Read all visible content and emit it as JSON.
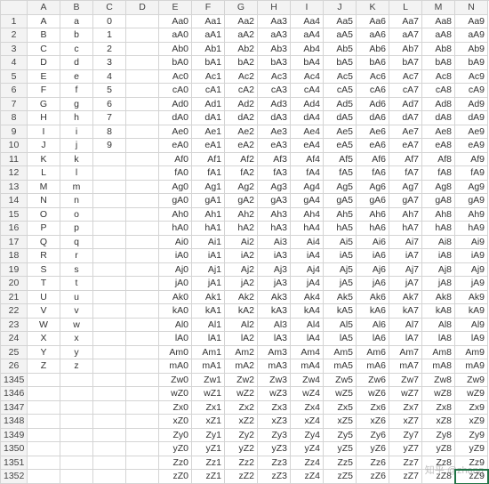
{
  "columns": [
    "A",
    "B",
    "C",
    "D",
    "E",
    "F",
    "G",
    "H",
    "I",
    "J",
    "K",
    "L",
    "M",
    "N"
  ],
  "rows": [
    {
      "n": "1",
      "A": "A",
      "B": "a",
      "C": "0",
      "D": "",
      "E": "Aa0",
      "F": "Aa1",
      "G": "Aa2",
      "H": "Aa3",
      "I": "Aa4",
      "J": "Aa5",
      "K": "Aa6",
      "L": "Aa7",
      "M": "Aa8",
      "N": "Aa9"
    },
    {
      "n": "2",
      "A": "B",
      "B": "b",
      "C": "1",
      "D": "",
      "E": "aA0",
      "F": "aA1",
      "G": "aA2",
      "H": "aA3",
      "I": "aA4",
      "J": "aA5",
      "K": "aA6",
      "L": "aA7",
      "M": "aA8",
      "N": "aA9"
    },
    {
      "n": "3",
      "A": "C",
      "B": "c",
      "C": "2",
      "D": "",
      "E": "Ab0",
      "F": "Ab1",
      "G": "Ab2",
      "H": "Ab3",
      "I": "Ab4",
      "J": "Ab5",
      "K": "Ab6",
      "L": "Ab7",
      "M": "Ab8",
      "N": "Ab9"
    },
    {
      "n": "4",
      "A": "D",
      "B": "d",
      "C": "3",
      "D": "",
      "E": "bA0",
      "F": "bA1",
      "G": "bA2",
      "H": "bA3",
      "I": "bA4",
      "J": "bA5",
      "K": "bA6",
      "L": "bA7",
      "M": "bA8",
      "N": "bA9"
    },
    {
      "n": "5",
      "A": "E",
      "B": "e",
      "C": "4",
      "D": "",
      "E": "Ac0",
      "F": "Ac1",
      "G": "Ac2",
      "H": "Ac3",
      "I": "Ac4",
      "J": "Ac5",
      "K": "Ac6",
      "L": "Ac7",
      "M": "Ac8",
      "N": "Ac9"
    },
    {
      "n": "6",
      "A": "F",
      "B": "f",
      "C": "5",
      "D": "",
      "E": "cA0",
      "F": "cA1",
      "G": "cA2",
      "H": "cA3",
      "I": "cA4",
      "J": "cA5",
      "K": "cA6",
      "L": "cA7",
      "M": "cA8",
      "N": "cA9"
    },
    {
      "n": "7",
      "A": "G",
      "B": "g",
      "C": "6",
      "D": "",
      "E": "Ad0",
      "F": "Ad1",
      "G": "Ad2",
      "H": "Ad3",
      "I": "Ad4",
      "J": "Ad5",
      "K": "Ad6",
      "L": "Ad7",
      "M": "Ad8",
      "N": "Ad9"
    },
    {
      "n": "8",
      "A": "H",
      "B": "h",
      "C": "7",
      "D": "",
      "E": "dA0",
      "F": "dA1",
      "G": "dA2",
      "H": "dA3",
      "I": "dA4",
      "J": "dA5",
      "K": "dA6",
      "L": "dA7",
      "M": "dA8",
      "N": "dA9"
    },
    {
      "n": "9",
      "A": "I",
      "B": "i",
      "C": "8",
      "D": "",
      "E": "Ae0",
      "F": "Ae1",
      "G": "Ae2",
      "H": "Ae3",
      "I": "Ae4",
      "J": "Ae5",
      "K": "Ae6",
      "L": "Ae7",
      "M": "Ae8",
      "N": "Ae9"
    },
    {
      "n": "10",
      "A": "J",
      "B": "j",
      "C": "9",
      "D": "",
      "E": "eA0",
      "F": "eA1",
      "G": "eA2",
      "H": "eA3",
      "I": "eA4",
      "J": "eA5",
      "K": "eA6",
      "L": "eA7",
      "M": "eA8",
      "N": "eA9"
    },
    {
      "n": "11",
      "A": "K",
      "B": "k",
      "C": "",
      "D": "",
      "E": "Af0",
      "F": "Af1",
      "G": "Af2",
      "H": "Af3",
      "I": "Af4",
      "J": "Af5",
      "K": "Af6",
      "L": "Af7",
      "M": "Af8",
      "N": "Af9"
    },
    {
      "n": "12",
      "A": "L",
      "B": "l",
      "C": "",
      "D": "",
      "E": "fA0",
      "F": "fA1",
      "G": "fA2",
      "H": "fA3",
      "I": "fA4",
      "J": "fA5",
      "K": "fA6",
      "L": "fA7",
      "M": "fA8",
      "N": "fA9"
    },
    {
      "n": "13",
      "A": "M",
      "B": "m",
      "C": "",
      "D": "",
      "E": "Ag0",
      "F": "Ag1",
      "G": "Ag2",
      "H": "Ag3",
      "I": "Ag4",
      "J": "Ag5",
      "K": "Ag6",
      "L": "Ag7",
      "M": "Ag8",
      "N": "Ag9"
    },
    {
      "n": "14",
      "A": "N",
      "B": "n",
      "C": "",
      "D": "",
      "E": "gA0",
      "F": "gA1",
      "G": "gA2",
      "H": "gA3",
      "I": "gA4",
      "J": "gA5",
      "K": "gA6",
      "L": "gA7",
      "M": "gA8",
      "N": "gA9"
    },
    {
      "n": "15",
      "A": "O",
      "B": "o",
      "C": "",
      "D": "",
      "E": "Ah0",
      "F": "Ah1",
      "G": "Ah2",
      "H": "Ah3",
      "I": "Ah4",
      "J": "Ah5",
      "K": "Ah6",
      "L": "Ah7",
      "M": "Ah8",
      "N": "Ah9"
    },
    {
      "n": "16",
      "A": "P",
      "B": "p",
      "C": "",
      "D": "",
      "E": "hA0",
      "F": "hA1",
      "G": "hA2",
      "H": "hA3",
      "I": "hA4",
      "J": "hA5",
      "K": "hA6",
      "L": "hA7",
      "M": "hA8",
      "N": "hA9"
    },
    {
      "n": "17",
      "A": "Q",
      "B": "q",
      "C": "",
      "D": "",
      "E": "Ai0",
      "F": "Ai1",
      "G": "Ai2",
      "H": "Ai3",
      "I": "Ai4",
      "J": "Ai5",
      "K": "Ai6",
      "L": "Ai7",
      "M": "Ai8",
      "N": "Ai9"
    },
    {
      "n": "18",
      "A": "R",
      "B": "r",
      "C": "",
      "D": "",
      "E": "iA0",
      "F": "iA1",
      "G": "iA2",
      "H": "iA3",
      "I": "iA4",
      "J": "iA5",
      "K": "iA6",
      "L": "iA7",
      "M": "iA8",
      "N": "iA9"
    },
    {
      "n": "19",
      "A": "S",
      "B": "s",
      "C": "",
      "D": "",
      "E": "Aj0",
      "F": "Aj1",
      "G": "Aj2",
      "H": "Aj3",
      "I": "Aj4",
      "J": "Aj5",
      "K": "Aj6",
      "L": "Aj7",
      "M": "Aj8",
      "N": "Aj9"
    },
    {
      "n": "20",
      "A": "T",
      "B": "t",
      "C": "",
      "D": "",
      "E": "jA0",
      "F": "jA1",
      "G": "jA2",
      "H": "jA3",
      "I": "jA4",
      "J": "jA5",
      "K": "jA6",
      "L": "jA7",
      "M": "jA8",
      "N": "jA9"
    },
    {
      "n": "21",
      "A": "U",
      "B": "u",
      "C": "",
      "D": "",
      "E": "Ak0",
      "F": "Ak1",
      "G": "Ak2",
      "H": "Ak3",
      "I": "Ak4",
      "J": "Ak5",
      "K": "Ak6",
      "L": "Ak7",
      "M": "Ak8",
      "N": "Ak9"
    },
    {
      "n": "22",
      "A": "V",
      "B": "v",
      "C": "",
      "D": "",
      "E": "kA0",
      "F": "kA1",
      "G": "kA2",
      "H": "kA3",
      "I": "kA4",
      "J": "kA5",
      "K": "kA6",
      "L": "kA7",
      "M": "kA8",
      "N": "kA9"
    },
    {
      "n": "23",
      "A": "W",
      "B": "w",
      "C": "",
      "D": "",
      "E": "Al0",
      "F": "Al1",
      "G": "Al2",
      "H": "Al3",
      "I": "Al4",
      "J": "Al5",
      "K": "Al6",
      "L": "Al7",
      "M": "Al8",
      "N": "Al9"
    },
    {
      "n": "24",
      "A": "X",
      "B": "x",
      "C": "",
      "D": "",
      "E": "lA0",
      "F": "lA1",
      "G": "lA2",
      "H": "lA3",
      "I": "lA4",
      "J": "lA5",
      "K": "lA6",
      "L": "lA7",
      "M": "lA8",
      "N": "lA9"
    },
    {
      "n": "25",
      "A": "Y",
      "B": "y",
      "C": "",
      "D": "",
      "E": "Am0",
      "F": "Am1",
      "G": "Am2",
      "H": "Am3",
      "I": "Am4",
      "J": "Am5",
      "K": "Am6",
      "L": "Am7",
      "M": "Am8",
      "N": "Am9"
    },
    {
      "n": "26",
      "A": "Z",
      "B": "z",
      "C": "",
      "D": "",
      "E": "mA0",
      "F": "mA1",
      "G": "mA2",
      "H": "mA3",
      "I": "mA4",
      "J": "mA5",
      "K": "mA6",
      "L": "mA7",
      "M": "mA8",
      "N": "mA9"
    },
    {
      "n": "1345",
      "A": "",
      "B": "",
      "C": "",
      "D": "",
      "E": "Zw0",
      "F": "Zw1",
      "G": "Zw2",
      "H": "Zw3",
      "I": "Zw4",
      "J": "Zw5",
      "K": "Zw6",
      "L": "Zw7",
      "M": "Zw8",
      "N": "Zw9"
    },
    {
      "n": "1346",
      "A": "",
      "B": "",
      "C": "",
      "D": "",
      "E": "wZ0",
      "F": "wZ1",
      "G": "wZ2",
      "H": "wZ3",
      "I": "wZ4",
      "J": "wZ5",
      "K": "wZ6",
      "L": "wZ7",
      "M": "wZ8",
      "N": "wZ9"
    },
    {
      "n": "1347",
      "A": "",
      "B": "",
      "C": "",
      "D": "",
      "E": "Zx0",
      "F": "Zx1",
      "G": "Zx2",
      "H": "Zx3",
      "I": "Zx4",
      "J": "Zx5",
      "K": "Zx6",
      "L": "Zx7",
      "M": "Zx8",
      "N": "Zx9"
    },
    {
      "n": "1348",
      "A": "",
      "B": "",
      "C": "",
      "D": "",
      "E": "xZ0",
      "F": "xZ1",
      "G": "xZ2",
      "H": "xZ3",
      "I": "xZ4",
      "J": "xZ5",
      "K": "xZ6",
      "L": "xZ7",
      "M": "xZ8",
      "N": "xZ9"
    },
    {
      "n": "1349",
      "A": "",
      "B": "",
      "C": "",
      "D": "",
      "E": "Zy0",
      "F": "Zy1",
      "G": "Zy2",
      "H": "Zy3",
      "I": "Zy4",
      "J": "Zy5",
      "K": "Zy6",
      "L": "Zy7",
      "M": "Zy8",
      "N": "Zy9"
    },
    {
      "n": "1350",
      "A": "",
      "B": "",
      "C": "",
      "D": "",
      "E": "yZ0",
      "F": "yZ1",
      "G": "yZ2",
      "H": "yZ3",
      "I": "yZ4",
      "J": "yZ5",
      "K": "yZ6",
      "L": "yZ7",
      "M": "yZ8",
      "N": "yZ9"
    },
    {
      "n": "1351",
      "A": "",
      "B": "",
      "C": "",
      "D": "",
      "E": "Zz0",
      "F": "Zz1",
      "G": "Zz2",
      "H": "Zz3",
      "I": "Zz4",
      "J": "Zz5",
      "K": "Zz6",
      "L": "Zz7",
      "M": "Zz8",
      "N": "Zz9"
    },
    {
      "n": "1352",
      "A": "",
      "B": "",
      "C": "",
      "D": "",
      "E": "zZ0",
      "F": "zZ1",
      "G": "zZ2",
      "H": "zZ3",
      "I": "zZ4",
      "J": "zZ5",
      "K": "zZ6",
      "L": "zZ7",
      "M": "zZ8",
      "N": "zZ9"
    }
  ],
  "selected": {
    "row": "1352",
    "col": "N"
  },
  "watermark": "知乎 @zhang"
}
